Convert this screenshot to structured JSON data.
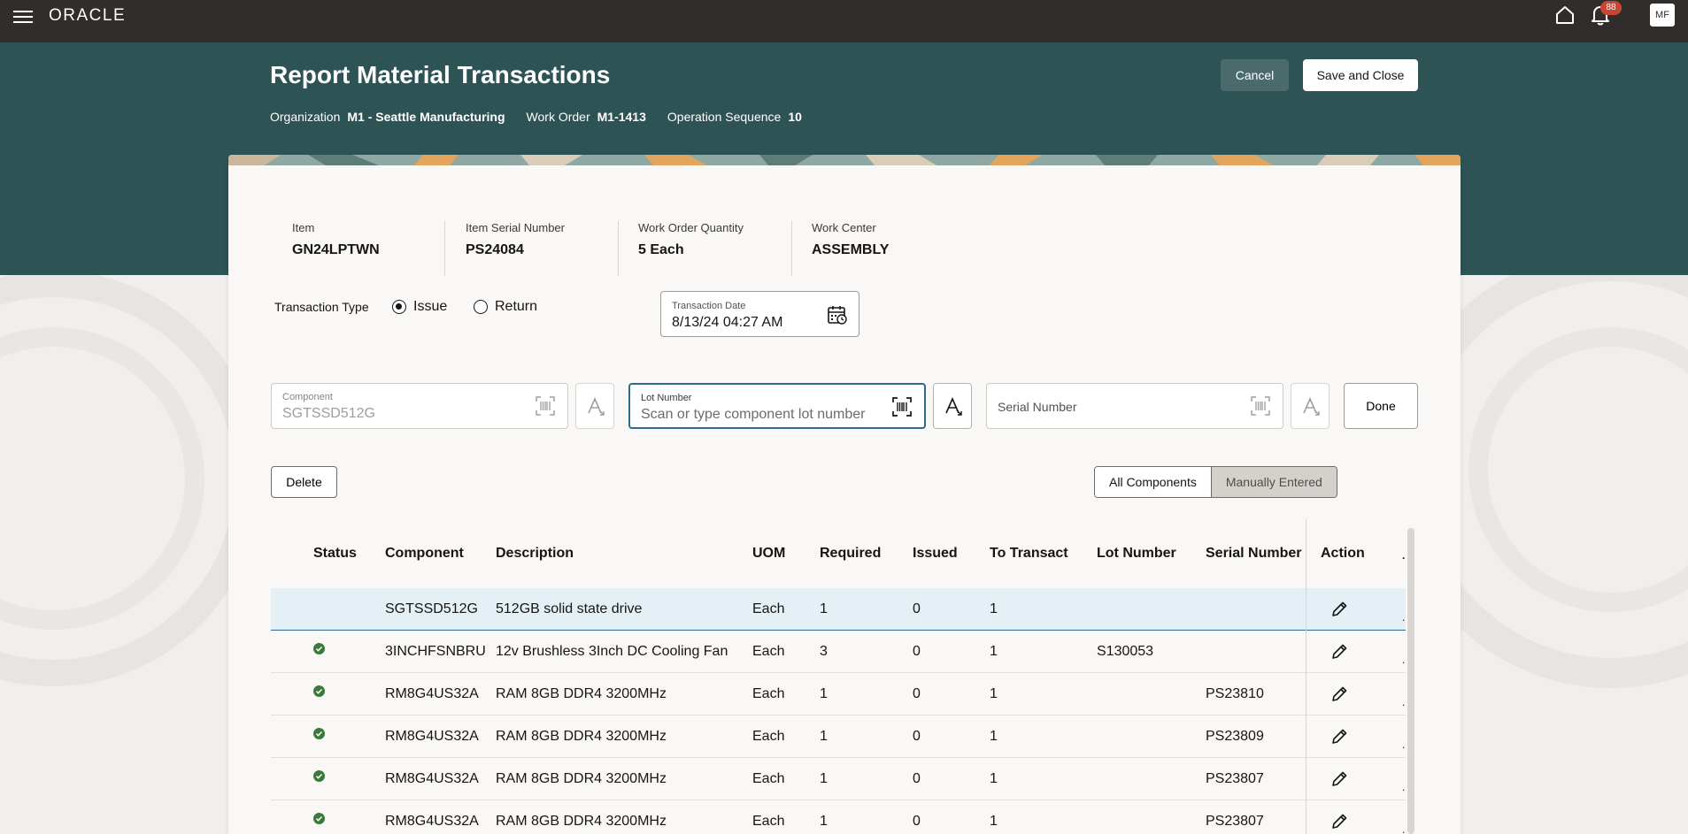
{
  "topbar": {
    "logo": "ORACLE",
    "notification_count": "88",
    "avatar_initials": "MF"
  },
  "header": {
    "title": "Report Material Transactions",
    "organization_label": "Organization",
    "organization_value": "M1 - Seattle Manufacturing",
    "work_order_label": "Work Order",
    "work_order_value": "M1-1413",
    "operation_sequence_label": "Operation Sequence",
    "operation_sequence_value": "10",
    "cancel_label": "Cancel",
    "save_close_label": "Save and Close"
  },
  "info": {
    "item_label": "Item",
    "item_value": "GN24LPTWN",
    "serial_label": "Item Serial Number",
    "serial_value": "PS24084",
    "quantity_label": "Work Order Quantity",
    "quantity_value": "5 Each",
    "work_center_label": "Work Center",
    "work_center_value": "ASSEMBLY"
  },
  "transaction": {
    "type_label": "Transaction Type",
    "issue_label": "Issue",
    "return_label": "Return",
    "selected": "Issue",
    "date_label": "Transaction Date",
    "date_value": "8/13/24 04:27 AM"
  },
  "scan": {
    "component_label": "Component",
    "component_value": "SGTSSD512G",
    "lot_label": "Lot Number",
    "lot_placeholder": "Scan or type component lot number",
    "serial_label": "Serial Number",
    "done_label": "Done"
  },
  "toolbar": {
    "delete_label": "Delete",
    "all_components_label": "All Components",
    "manually_entered_label": "Manually Entered",
    "selected_filter": "Manually Entered"
  },
  "table": {
    "headers": {
      "status": "Status",
      "component": "Component",
      "description": "Description",
      "uom": "UOM",
      "required": "Required",
      "issued": "Issued",
      "to_transact": "To Transact",
      "lot_number": "Lot Number",
      "serial_number": "Serial Number",
      "action": "Action"
    },
    "rows": [
      {
        "status": "",
        "component": "SGTSSD512G",
        "description": "512GB solid state drive",
        "uom": "Each",
        "required": "1",
        "issued": "0",
        "to_transact": "1",
        "lot_number": "",
        "serial_number": ""
      },
      {
        "status": "complete",
        "component": "3INCHFSNBRU",
        "description": "12v Brushless 3Inch DC Cooling Fan",
        "uom": "Each",
        "required": "3",
        "issued": "0",
        "to_transact": "1",
        "lot_number": "S130053",
        "serial_number": ""
      },
      {
        "status": "complete",
        "component": "RM8G4US32A",
        "description": "RAM 8GB DDR4 3200MHz",
        "uom": "Each",
        "required": "1",
        "issued": "0",
        "to_transact": "1",
        "lot_number": "",
        "serial_number": "PS23810"
      },
      {
        "status": "complete",
        "component": "RM8G4US32A",
        "description": "RAM 8GB DDR4 3200MHz",
        "uom": "Each",
        "required": "1",
        "issued": "0",
        "to_transact": "1",
        "lot_number": "",
        "serial_number": "PS23809"
      },
      {
        "status": "complete",
        "component": "RM8G4US32A",
        "description": "RAM 8GB DDR4 3200MHz",
        "uom": "Each",
        "required": "1",
        "issued": "0",
        "to_transact": "1",
        "lot_number": "",
        "serial_number": "PS23807"
      },
      {
        "status": "complete",
        "component": "RM8G4US32A",
        "description": "RAM 8GB DDR4 3200MHz",
        "uom": "Each",
        "required": "1",
        "issued": "0",
        "to_transact": "1",
        "lot_number": "",
        "serial_number": "PS23807"
      }
    ]
  },
  "icons": {
    "menu": "hamburger-icon",
    "home": "home-icon",
    "notifications": "bell-icon",
    "calendar": "calendar-icon",
    "barcode": "barcode-scan-icon",
    "ocr": "text-recognition-icon",
    "status_ok": "check-circle-icon",
    "edit": "pencil-icon"
  },
  "colors": {
    "topbar": "#312d2a",
    "header": "#2e5354",
    "selected_row": "#e4f0f5",
    "status_ok": "#3a7a3a",
    "notification_badge": "#c74634"
  }
}
